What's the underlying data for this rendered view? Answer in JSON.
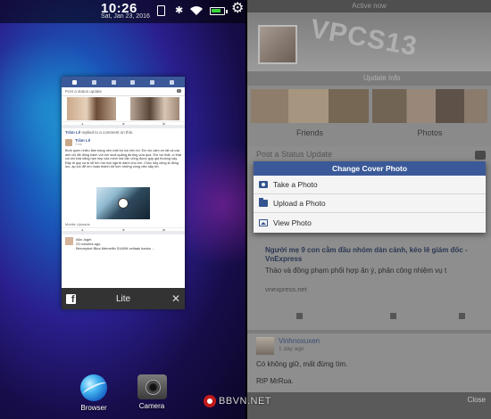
{
  "status_bar": {
    "time": "10:26",
    "ampm": "AM",
    "date": "Sat, Jan 23, 2016",
    "battery_level": 0.7,
    "icons": [
      "notification-icon",
      "bluetooth-icon",
      "wifi-icon",
      "battery-icon",
      "settings-gear-icon"
    ]
  },
  "app_card": {
    "status_placeholder": "Post a status update",
    "feed_meta_name": "Trâm Lê",
    "feed_meta_action": "replied to a comment on this.",
    "post_author": "Trâm Lê",
    "post_time": "3 hrs",
    "post_text": "Bình quen nhiều tâm trạng nên mất bù nói nên lời. Em xin cảm ơn tất cả các anh chị đã động hành với em suốt quãng đường vừa qua. Em vui thật, vì thật vui khi khả năng hạn hẹp của mình mà vẫn cũng được góp giá thuộng này. Đây là quy ca ai sẽ tìm mà mọi người dành cho em. Chúc dây cũng là động lực, áp lực để em hoàn thành tốt hơn những công việc sắp tới.",
    "mobile_uploads": "Mobile Uploads",
    "post3_author": "Alla Jugel",
    "post3_time": "23 minutes ago",
    "post3_text": "Beroepbot Blua Memelllo SUWM vellaak banks ...",
    "app_name": "Lite"
  },
  "dock": {
    "browser_label": "Browser",
    "camera_label": "Camera"
  },
  "watermark": "BBVN.NET",
  "profile": {
    "active_status": "Active now",
    "cover_text": "VPCS13",
    "update_info": "Update Info",
    "friends_label": "Friends",
    "photos_label": "Photos",
    "post_status_placeholder": "Post a Status Update"
  },
  "dialog": {
    "title": "Change Cover Photo",
    "items": [
      "Take a Photo",
      "Upload a Photo",
      "View Photo"
    ]
  },
  "news": {
    "title": "Người mẹ 9 con cằm đầu nhóm dàn cảnh, kéo lê giám đốc - VnExpress",
    "desc": "Thảo và đồng phạm phối hợp ăn ý, phân công nhiệm vụ t",
    "source": "vnexpress.net"
  },
  "post2": {
    "author": "Vinhnoxuxen",
    "time": "1 day ago",
    "text1": "Có không giữ, mất đừng tìm.",
    "text2": "RIP MrRua."
  },
  "bottom": {
    "close_label": "Close"
  }
}
